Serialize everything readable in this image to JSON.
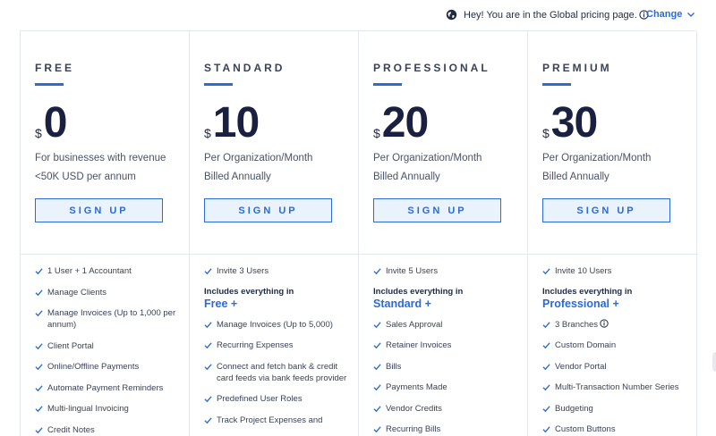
{
  "banner": {
    "region_text": "Hey! You are in the Global pricing page.",
    "change_label": "Change"
  },
  "plans": [
    {
      "name": "FREE",
      "currency": "$",
      "price": "0",
      "desc1": "For businesses with revenue",
      "desc2": "<50K USD per annum",
      "cta": "SIGN UP",
      "features": [
        "1 User + 1 Accountant",
        "Manage Clients",
        "Manage Invoices (Up to 1,000 per annum)",
        "Client Portal",
        "Online/Offline Payments",
        "Automate Payment Reminders",
        "Multi-lingual Invoicing",
        "Credit Notes"
      ]
    },
    {
      "name": "STANDARD",
      "currency": "$",
      "price": "10",
      "desc1": "Per Organization/Month",
      "desc2": "Billed Annually",
      "cta": "SIGN UP",
      "first_feature": "Invite 3 Users",
      "includes_label": "Includes everything in",
      "includes_plan": "Free +",
      "features": [
        "Manage Invoices (Up to 5,000)",
        "Recurring Expenses",
        "Connect and fetch bank & credit card feeds via bank feeds provider",
        "Predefined User Roles",
        "Track Project Expenses and"
      ]
    },
    {
      "name": "PROFESSIONAL",
      "currency": "$",
      "price": "20",
      "desc1": "Per Organization/Month",
      "desc2": "Billed Annually",
      "cta": "SIGN UP",
      "first_feature": "Invite 5 Users",
      "includes_label": "Includes everything in",
      "includes_plan": "Standard +",
      "features": [
        "Sales Approval",
        "Retainer Invoices",
        "Bills",
        "Payments Made",
        "Vendor Credits",
        "Recurring Bills"
      ]
    },
    {
      "name": "PREMIUM",
      "currency": "$",
      "price": "30",
      "desc1": "Per Organization/Month",
      "desc2": "Billed Annually",
      "cta": "SIGN UP",
      "first_feature": "Invite 10 Users",
      "includes_label": "Includes everything in",
      "includes_plan": "Professional +",
      "features": [
        "3 Branches",
        "Custom Domain",
        "Vendor Portal",
        "Multi-Transaction Number Series",
        "Budgeting",
        "Custom Buttons"
      ]
    }
  ],
  "colors": {
    "accent": "#2b6bd6",
    "button_bg": "#eaf2fc",
    "text": "#1f2a44",
    "border": "#e3e7ee"
  },
  "icons": {
    "region": "globe-icon",
    "info": "info-icon",
    "change": "chevron-down-icon",
    "feature": "check-icon"
  }
}
